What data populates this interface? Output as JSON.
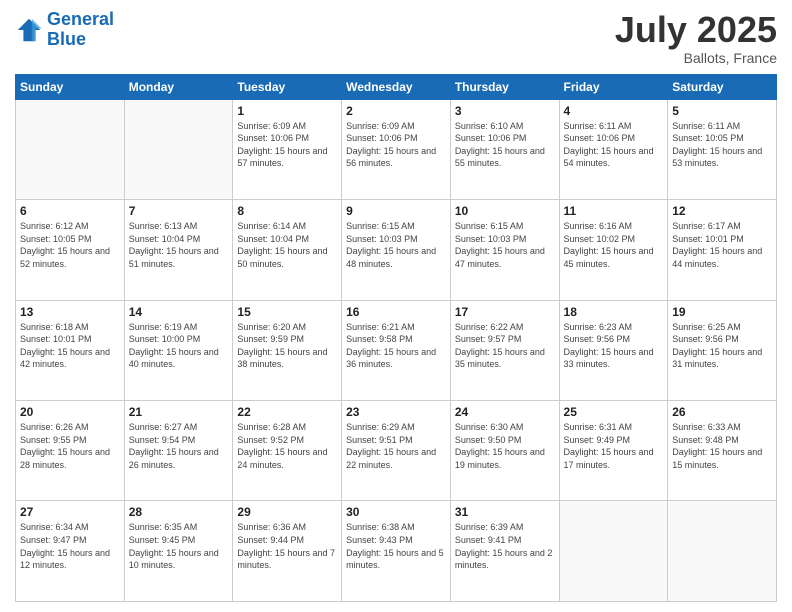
{
  "logo": {
    "line1": "General",
    "line2": "Blue"
  },
  "header": {
    "month": "July 2025",
    "location": "Ballots, France"
  },
  "weekdays": [
    "Sunday",
    "Monday",
    "Tuesday",
    "Wednesday",
    "Thursday",
    "Friday",
    "Saturday"
  ],
  "weeks": [
    [
      {
        "day": "",
        "sunrise": "",
        "sunset": "",
        "daylight": ""
      },
      {
        "day": "",
        "sunrise": "",
        "sunset": "",
        "daylight": ""
      },
      {
        "day": "1",
        "sunrise": "Sunrise: 6:09 AM",
        "sunset": "Sunset: 10:06 PM",
        "daylight": "Daylight: 15 hours and 57 minutes."
      },
      {
        "day": "2",
        "sunrise": "Sunrise: 6:09 AM",
        "sunset": "Sunset: 10:06 PM",
        "daylight": "Daylight: 15 hours and 56 minutes."
      },
      {
        "day": "3",
        "sunrise": "Sunrise: 6:10 AM",
        "sunset": "Sunset: 10:06 PM",
        "daylight": "Daylight: 15 hours and 55 minutes."
      },
      {
        "day": "4",
        "sunrise": "Sunrise: 6:11 AM",
        "sunset": "Sunset: 10:06 PM",
        "daylight": "Daylight: 15 hours and 54 minutes."
      },
      {
        "day": "5",
        "sunrise": "Sunrise: 6:11 AM",
        "sunset": "Sunset: 10:05 PM",
        "daylight": "Daylight: 15 hours and 53 minutes."
      }
    ],
    [
      {
        "day": "6",
        "sunrise": "Sunrise: 6:12 AM",
        "sunset": "Sunset: 10:05 PM",
        "daylight": "Daylight: 15 hours and 52 minutes."
      },
      {
        "day": "7",
        "sunrise": "Sunrise: 6:13 AM",
        "sunset": "Sunset: 10:04 PM",
        "daylight": "Daylight: 15 hours and 51 minutes."
      },
      {
        "day": "8",
        "sunrise": "Sunrise: 6:14 AM",
        "sunset": "Sunset: 10:04 PM",
        "daylight": "Daylight: 15 hours and 50 minutes."
      },
      {
        "day": "9",
        "sunrise": "Sunrise: 6:15 AM",
        "sunset": "Sunset: 10:03 PM",
        "daylight": "Daylight: 15 hours and 48 minutes."
      },
      {
        "day": "10",
        "sunrise": "Sunrise: 6:15 AM",
        "sunset": "Sunset: 10:03 PM",
        "daylight": "Daylight: 15 hours and 47 minutes."
      },
      {
        "day": "11",
        "sunrise": "Sunrise: 6:16 AM",
        "sunset": "Sunset: 10:02 PM",
        "daylight": "Daylight: 15 hours and 45 minutes."
      },
      {
        "day": "12",
        "sunrise": "Sunrise: 6:17 AM",
        "sunset": "Sunset: 10:01 PM",
        "daylight": "Daylight: 15 hours and 44 minutes."
      }
    ],
    [
      {
        "day": "13",
        "sunrise": "Sunrise: 6:18 AM",
        "sunset": "Sunset: 10:01 PM",
        "daylight": "Daylight: 15 hours and 42 minutes."
      },
      {
        "day": "14",
        "sunrise": "Sunrise: 6:19 AM",
        "sunset": "Sunset: 10:00 PM",
        "daylight": "Daylight: 15 hours and 40 minutes."
      },
      {
        "day": "15",
        "sunrise": "Sunrise: 6:20 AM",
        "sunset": "Sunset: 9:59 PM",
        "daylight": "Daylight: 15 hours and 38 minutes."
      },
      {
        "day": "16",
        "sunrise": "Sunrise: 6:21 AM",
        "sunset": "Sunset: 9:58 PM",
        "daylight": "Daylight: 15 hours and 36 minutes."
      },
      {
        "day": "17",
        "sunrise": "Sunrise: 6:22 AM",
        "sunset": "Sunset: 9:57 PM",
        "daylight": "Daylight: 15 hours and 35 minutes."
      },
      {
        "day": "18",
        "sunrise": "Sunrise: 6:23 AM",
        "sunset": "Sunset: 9:56 PM",
        "daylight": "Daylight: 15 hours and 33 minutes."
      },
      {
        "day": "19",
        "sunrise": "Sunrise: 6:25 AM",
        "sunset": "Sunset: 9:56 PM",
        "daylight": "Daylight: 15 hours and 31 minutes."
      }
    ],
    [
      {
        "day": "20",
        "sunrise": "Sunrise: 6:26 AM",
        "sunset": "Sunset: 9:55 PM",
        "daylight": "Daylight: 15 hours and 28 minutes."
      },
      {
        "day": "21",
        "sunrise": "Sunrise: 6:27 AM",
        "sunset": "Sunset: 9:54 PM",
        "daylight": "Daylight: 15 hours and 26 minutes."
      },
      {
        "day": "22",
        "sunrise": "Sunrise: 6:28 AM",
        "sunset": "Sunset: 9:52 PM",
        "daylight": "Daylight: 15 hours and 24 minutes."
      },
      {
        "day": "23",
        "sunrise": "Sunrise: 6:29 AM",
        "sunset": "Sunset: 9:51 PM",
        "daylight": "Daylight: 15 hours and 22 minutes."
      },
      {
        "day": "24",
        "sunrise": "Sunrise: 6:30 AM",
        "sunset": "Sunset: 9:50 PM",
        "daylight": "Daylight: 15 hours and 19 minutes."
      },
      {
        "day": "25",
        "sunrise": "Sunrise: 6:31 AM",
        "sunset": "Sunset: 9:49 PM",
        "daylight": "Daylight: 15 hours and 17 minutes."
      },
      {
        "day": "26",
        "sunrise": "Sunrise: 6:33 AM",
        "sunset": "Sunset: 9:48 PM",
        "daylight": "Daylight: 15 hours and 15 minutes."
      }
    ],
    [
      {
        "day": "27",
        "sunrise": "Sunrise: 6:34 AM",
        "sunset": "Sunset: 9:47 PM",
        "daylight": "Daylight: 15 hours and 12 minutes."
      },
      {
        "day": "28",
        "sunrise": "Sunrise: 6:35 AM",
        "sunset": "Sunset: 9:45 PM",
        "daylight": "Daylight: 15 hours and 10 minutes."
      },
      {
        "day": "29",
        "sunrise": "Sunrise: 6:36 AM",
        "sunset": "Sunset: 9:44 PM",
        "daylight": "Daylight: 15 hours and 7 minutes."
      },
      {
        "day": "30",
        "sunrise": "Sunrise: 6:38 AM",
        "sunset": "Sunset: 9:43 PM",
        "daylight": "Daylight: 15 hours and 5 minutes."
      },
      {
        "day": "31",
        "sunrise": "Sunrise: 6:39 AM",
        "sunset": "Sunset: 9:41 PM",
        "daylight": "Daylight: 15 hours and 2 minutes."
      },
      {
        "day": "",
        "sunrise": "",
        "sunset": "",
        "daylight": ""
      },
      {
        "day": "",
        "sunrise": "",
        "sunset": "",
        "daylight": ""
      }
    ]
  ]
}
